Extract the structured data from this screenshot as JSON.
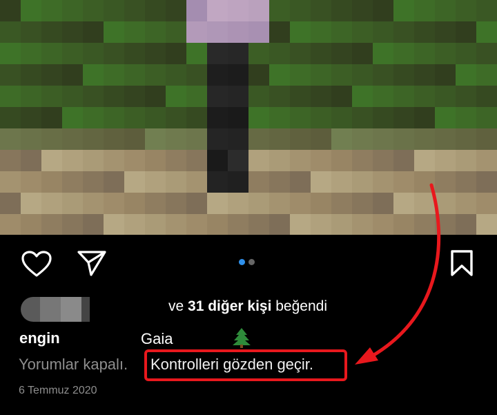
{
  "post": {
    "like_prefix": "ve ",
    "like_count_text": "31 diğer kişi",
    "like_suffix": " beğendi",
    "username": "engin",
    "caption": "Gaia",
    "comments_closed": "Yorumlar kapalı.",
    "review_link": "Kontrolleri gözden geçir.",
    "date": "6 Temmuz 2020",
    "carousel_active_index": 0,
    "carousel_count": 2
  },
  "icons": [
    "heart-icon",
    "share-icon",
    "bookmark-icon",
    "tree-emoji-icon"
  ],
  "colors": {
    "background": "#000000",
    "carousel_active": "#2f90ea",
    "muted_text": "#8e8e8e",
    "annotation_red": "#e8181d"
  }
}
